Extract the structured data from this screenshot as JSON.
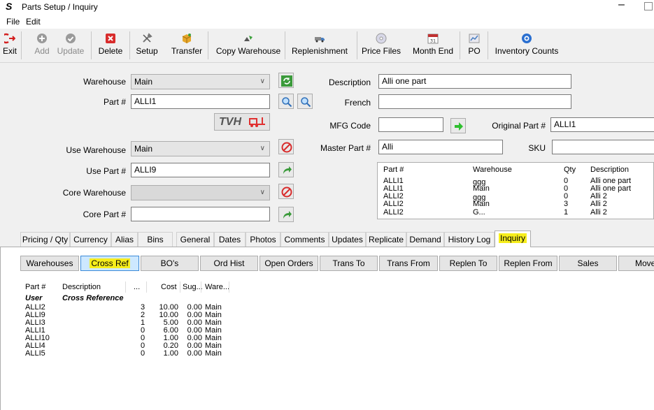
{
  "window": {
    "title": "Parts Setup / Inquiry"
  },
  "menu": [
    "File",
    "Edit"
  ],
  "toolbar": [
    {
      "label": "Exit"
    },
    {
      "label": "Add"
    },
    {
      "label": "Update"
    },
    {
      "label": "Delete"
    },
    {
      "label": "Setup"
    },
    {
      "label": "Transfer"
    },
    {
      "label": "Copy Warehouse"
    },
    {
      "label": "Replenishment"
    },
    {
      "label": "Price Files"
    },
    {
      "label": "Month End"
    },
    {
      "label": "PO"
    },
    {
      "label": "Inventory Counts"
    }
  ],
  "toolbar_icon_text": {
    "month_end": "31"
  },
  "form": {
    "warehouse_label": "Warehouse",
    "warehouse_value": "Main",
    "part_label": "Part #",
    "part_value": "ALLI1",
    "logo_text": "TVH",
    "use_warehouse_label": "Use Warehouse",
    "use_warehouse_value": "Main",
    "use_part_label": "Use Part #",
    "use_part_value": "ALLI9",
    "core_warehouse_label": "Core Warehouse",
    "core_warehouse_value": "",
    "core_part_label": "Core Part #",
    "core_part_value": "",
    "description_label": "Description",
    "description_value": "Alli one part",
    "french_label": "French",
    "french_value": "",
    "mfg_code_label": "MFG Code",
    "mfg_code_value": "",
    "original_part_label": "Original Part #",
    "original_part_value": "ALLI1",
    "master_part_label": "Master Part #",
    "master_part_value": "Alli",
    "sku_label": "SKU",
    "sku_value": ""
  },
  "warehouse_grid": {
    "headers": [
      "Part #",
      "Warehouse",
      "Qty",
      "Description"
    ],
    "rows": [
      [
        "ALLI1",
        "ggg",
        "0",
        "Alli one part"
      ],
      [
        "ALLI1",
        "Main",
        "0",
        "Alli one part"
      ],
      [
        "ALLI2",
        "ggg",
        "0",
        "Alli 2"
      ],
      [
        "ALLI2",
        "Main",
        "3",
        "Alli 2"
      ],
      [
        "ALLI2",
        "G...",
        "1",
        "Alli 2"
      ]
    ]
  },
  "main_tabs": [
    "Pricing / Qty",
    "Currency",
    "Alias",
    "Bins",
    "General",
    "Dates",
    "Photos",
    "Comments",
    "Updates",
    "Replicate",
    "Demand",
    "History Log",
    "Inquiry"
  ],
  "inquiry_tabs": [
    "Warehouses",
    "Cross Ref",
    "BO's",
    "Ord Hist",
    "Open Orders",
    "Trans To",
    "Trans From",
    "Replen To",
    "Replen From",
    "Sales",
    "Movem"
  ],
  "cross_ref": {
    "headers": [
      "Part #",
      "Description",
      "...",
      "Cost",
      "Sug...",
      "Ware..."
    ],
    "group_row": [
      "User",
      "Cross Reference"
    ],
    "rows": [
      [
        "ALLI2",
        "",
        "3",
        "10.00",
        "0.00",
        "Main"
      ],
      [
        "ALLI9",
        "",
        "2",
        "10.00",
        "0.00",
        "Main"
      ],
      [
        "ALLI3",
        "",
        "1",
        "5.00",
        "0.00",
        "Main"
      ],
      [
        "ALLI1",
        "",
        "0",
        "6.00",
        "0.00",
        "Main"
      ],
      [
        "ALLI10",
        "",
        "0",
        "1.00",
        "0.00",
        "Main"
      ],
      [
        "ALLI4",
        "",
        "0",
        "0.20",
        "0.00",
        "Main"
      ],
      [
        "ALLI5",
        "",
        "0",
        "1.00",
        "0.00",
        "Main"
      ]
    ]
  },
  "colors": {
    "highlight": "#f7ee1d",
    "active_tab": "#cde8ff",
    "accent": "#3c8ad8"
  }
}
